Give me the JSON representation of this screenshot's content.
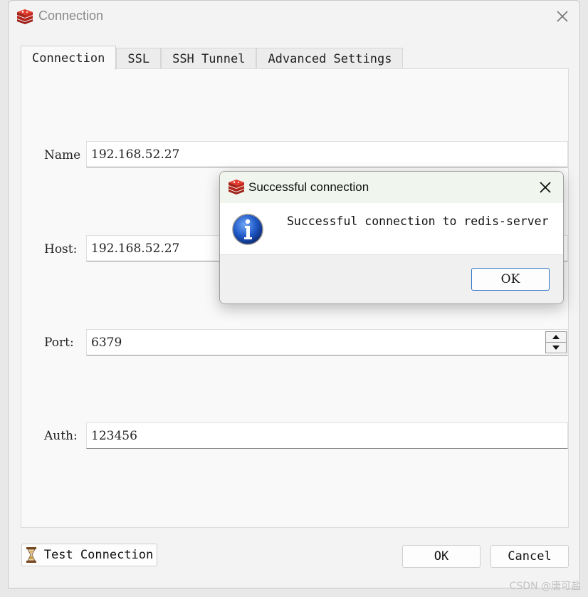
{
  "window": {
    "title": "Connection"
  },
  "tabs": [
    {
      "label": "Connection",
      "active": true
    },
    {
      "label": "SSL",
      "active": false
    },
    {
      "label": "SSH Tunnel",
      "active": false
    },
    {
      "label": "Advanced Settings",
      "active": false
    }
  ],
  "form": {
    "name_label": "Name",
    "name_value": "192.168.52.27",
    "host_label": "Host:",
    "host_value": "192.168.52.27",
    "port_label": "Port:",
    "port_value": "6379",
    "auth_label": "Auth:",
    "auth_value": "123456"
  },
  "buttons": {
    "test_connection": "Test Connection",
    "ok": "OK",
    "cancel": "Cancel"
  },
  "dialog": {
    "title": "Successful connection",
    "message": "Successful connection to redis-server",
    "ok": "OK"
  },
  "watermark": "CSDN @唐可盐",
  "colors": {
    "redis_red": "#d82c20",
    "info_blue": "#1f58c7",
    "dialog_ok_border": "#2f74c7"
  }
}
